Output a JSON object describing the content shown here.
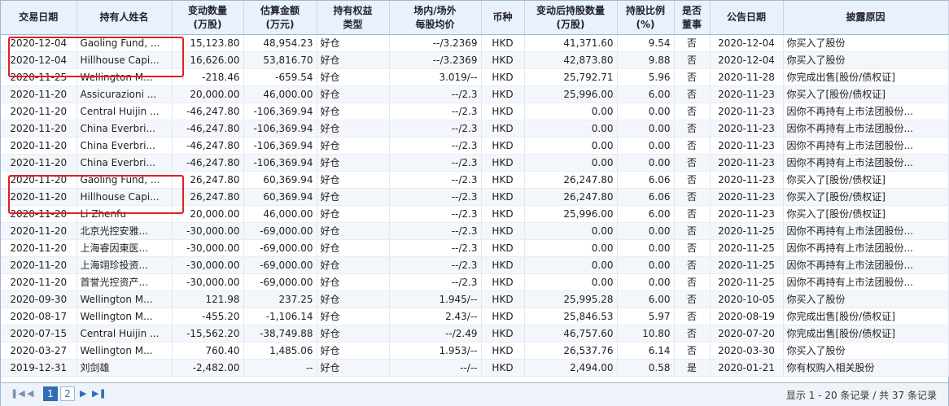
{
  "headers": [
    {
      "line1": "交易日期",
      "line2": ""
    },
    {
      "line1": "持有人姓名",
      "line2": ""
    },
    {
      "line1": "变动数量",
      "line2": "(万股)"
    },
    {
      "line1": "估算金额",
      "line2": "(万元)"
    },
    {
      "line1": "持有权益",
      "line2": "类型"
    },
    {
      "line1": "场内/场外",
      "line2": "每股均价"
    },
    {
      "line1": "币种",
      "line2": ""
    },
    {
      "line1": "变动后持股数量",
      "line2": "(万股)"
    },
    {
      "line1": "持股比例",
      "line2": "(%)"
    },
    {
      "line1": "是否",
      "line2": "董事"
    },
    {
      "line1": "公告日期",
      "line2": ""
    },
    {
      "line1": "披露原因",
      "line2": ""
    }
  ],
  "rows": [
    [
      "2020-12-04",
      "Gaoling Fund, ...",
      "15,123.80",
      "48,954.23",
      "好仓",
      "--/3.2369",
      "HKD",
      "41,371.60",
      "9.54",
      "否",
      "2020-12-04",
      "你买入了股份"
    ],
    [
      "2020-12-04",
      "Hillhouse Capi...",
      "16,626.00",
      "53,816.70",
      "好仓",
      "--/3.2369",
      "HKD",
      "42,873.80",
      "9.88",
      "否",
      "2020-12-04",
      "你买入了股份"
    ],
    [
      "2020-11-25",
      "Wellington M...",
      "-218.46",
      "-659.54",
      "好仓",
      "3.019/--",
      "HKD",
      "25,792.71",
      "5.96",
      "否",
      "2020-11-28",
      "你完成出售[股份/债权证]"
    ],
    [
      "2020-11-20",
      "Assicurazioni ...",
      "20,000.00",
      "46,000.00",
      "好仓",
      "--/2.3",
      "HKD",
      "25,996.00",
      "6.00",
      "否",
      "2020-11-23",
      "你买入了[股份/债权证]"
    ],
    [
      "2020-11-20",
      "Central Huijin ...",
      "-46,247.80",
      "-106,369.94",
      "好仓",
      "--/2.3",
      "HKD",
      "0.00",
      "0.00",
      "否",
      "2020-11-23",
      "因你不再持有上市法团股份..."
    ],
    [
      "2020-11-20",
      "China Everbri...",
      "-46,247.80",
      "-106,369.94",
      "好仓",
      "--/2.3",
      "HKD",
      "0.00",
      "0.00",
      "否",
      "2020-11-23",
      "因你不再持有上市法团股份..."
    ],
    [
      "2020-11-20",
      "China Everbri...",
      "-46,247.80",
      "-106,369.94",
      "好仓",
      "--/2.3",
      "HKD",
      "0.00",
      "0.00",
      "否",
      "2020-11-23",
      "因你不再持有上市法团股份..."
    ],
    [
      "2020-11-20",
      "China Everbri...",
      "-46,247.80",
      "-106,369.94",
      "好仓",
      "--/2.3",
      "HKD",
      "0.00",
      "0.00",
      "否",
      "2020-11-23",
      "因你不再持有上市法团股份..."
    ],
    [
      "2020-11-20",
      "Gaoling Fund, ...",
      "26,247.80",
      "60,369.94",
      "好仓",
      "--/2.3",
      "HKD",
      "26,247.80",
      "6.06",
      "否",
      "2020-11-23",
      "你买入了[股份/债权证]"
    ],
    [
      "2020-11-20",
      "Hillhouse Capi...",
      "26,247.80",
      "60,369.94",
      "好仓",
      "--/2.3",
      "HKD",
      "26,247.80",
      "6.06",
      "否",
      "2020-11-23",
      "你买入了[股份/债权证]"
    ],
    [
      "2020-11-20",
      "Li Zhenfu",
      "20,000.00",
      "46,000.00",
      "好仓",
      "--/2.3",
      "HKD",
      "25,996.00",
      "6.00",
      "否",
      "2020-11-23",
      "你买入了[股份/债权证]"
    ],
    [
      "2020-11-20",
      "北京光控安雅...",
      "-30,000.00",
      "-69,000.00",
      "好仓",
      "--/2.3",
      "HKD",
      "0.00",
      "0.00",
      "否",
      "2020-11-25",
      "因你不再持有上市法团股份..."
    ],
    [
      "2020-11-20",
      "上海睿因東医...",
      "-30,000.00",
      "-69,000.00",
      "好仓",
      "--/2.3",
      "HKD",
      "0.00",
      "0.00",
      "否",
      "2020-11-25",
      "因你不再持有上市法团股份..."
    ],
    [
      "2020-11-20",
      "上海翊珍投资...",
      "-30,000.00",
      "-69,000.00",
      "好仓",
      "--/2.3",
      "HKD",
      "0.00",
      "0.00",
      "否",
      "2020-11-25",
      "因你不再持有上市法团股份..."
    ],
    [
      "2020-11-20",
      "首誉光控资产...",
      "-30,000.00",
      "-69,000.00",
      "好仓",
      "--/2.3",
      "HKD",
      "0.00",
      "0.00",
      "否",
      "2020-11-25",
      "因你不再持有上市法团股份..."
    ],
    [
      "2020-09-30",
      "Wellington M...",
      "121.98",
      "237.25",
      "好仓",
      "1.945/--",
      "HKD",
      "25,995.28",
      "6.00",
      "否",
      "2020-10-05",
      "你买入了股份"
    ],
    [
      "2020-08-17",
      "Wellington M...",
      "-455.20",
      "-1,106.14",
      "好仓",
      "2.43/--",
      "HKD",
      "25,846.53",
      "5.97",
      "否",
      "2020-08-19",
      "你完成出售[股份/债权证]"
    ],
    [
      "2020-07-15",
      "Central Huijin ...",
      "-15,562.20",
      "-38,749.88",
      "好仓",
      "--/2.49",
      "HKD",
      "46,757.60",
      "10.80",
      "否",
      "2020-07-20",
      "你完成出售[股份/债权证]"
    ],
    [
      "2020-03-27",
      "Wellington M...",
      "760.40",
      "1,485.06",
      "好仓",
      "1.953/--",
      "HKD",
      "26,537.76",
      "6.14",
      "否",
      "2020-03-30",
      "你买入了股份"
    ],
    [
      "2019-12-31",
      "刘剑雄",
      "-2,482.00",
      "--",
      "好仓",
      "--/--",
      "HKD",
      "2,494.00",
      "0.58",
      "是",
      "2020-01-21",
      "你有权购入相关股份"
    ]
  ],
  "pagination": {
    "first_icon": "first-page-icon",
    "prev_icon": "prev-page-icon",
    "next_icon": "next-page-icon",
    "last_icon": "last-page-icon",
    "page1": "1",
    "page2": "2",
    "info": "显示 1 - 20 条记录 / 共 37 条记录"
  },
  "highlight_color": "#e02020"
}
